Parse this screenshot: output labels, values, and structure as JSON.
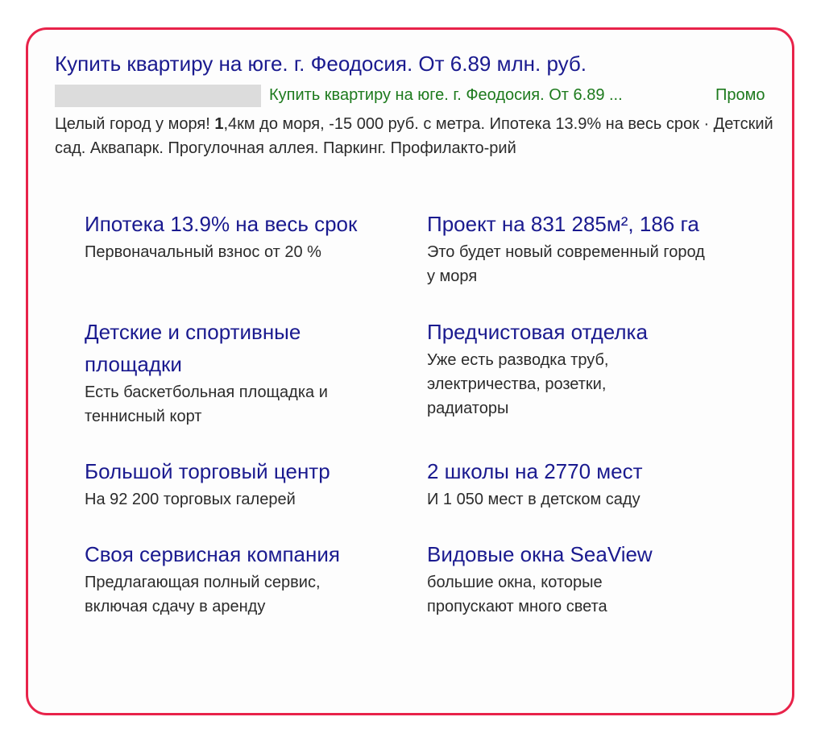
{
  "ad": {
    "title": "Купить квартиру на юге. г. Феодосия. От 6.89 млн. руб.",
    "url_text": "Купить квартиру на юге. г. Феодосия. От 6.89 ...",
    "url_promo": "Промо",
    "description_pre": "Целый город у моря! ",
    "description_bold": "1",
    "description_post": ",4км до моря, -15 000 руб. с метра. Ипотека 13.9% на весь срок · Детский сад. Аквапарк. Прогулочная аллея. Паркинг. Профилакто-рий"
  },
  "sitelinks": [
    {
      "title": "Ипотека 13.9% на весь срок",
      "desc": "Первоначальный взнос от 20 %"
    },
    {
      "title": "Проект на 831 285м², 186 га",
      "desc": "Это будет новый современный город у моря"
    },
    {
      "title": "Детские и спортивные площадки",
      "desc": "Есть баскетбольная площадка и теннисный корт"
    },
    {
      "title": "Предчистовая отделка",
      "desc": "Уже есть разводка труб, электричества, розетки, радиаторы"
    },
    {
      "title": "Большой торговый центр",
      "desc": "На 92 200 торговых галерей"
    },
    {
      "title": "2 школы на 2770 мест",
      "desc": "И 1 050 мест в детском саду"
    },
    {
      "title": "Своя сервисная компания",
      "desc": "Предлагающая полный сервис, включая сдачу в аренду"
    },
    {
      "title": "Видовые окна SeaView",
      "desc": "большие окна, которые пропускают много света"
    }
  ],
  "colors": {
    "frame_border": "#e8234a",
    "link": "#1a1a8f",
    "url": "#1d7a1d",
    "text": "#2b2b2b",
    "redaction": "#dcdcdc"
  }
}
